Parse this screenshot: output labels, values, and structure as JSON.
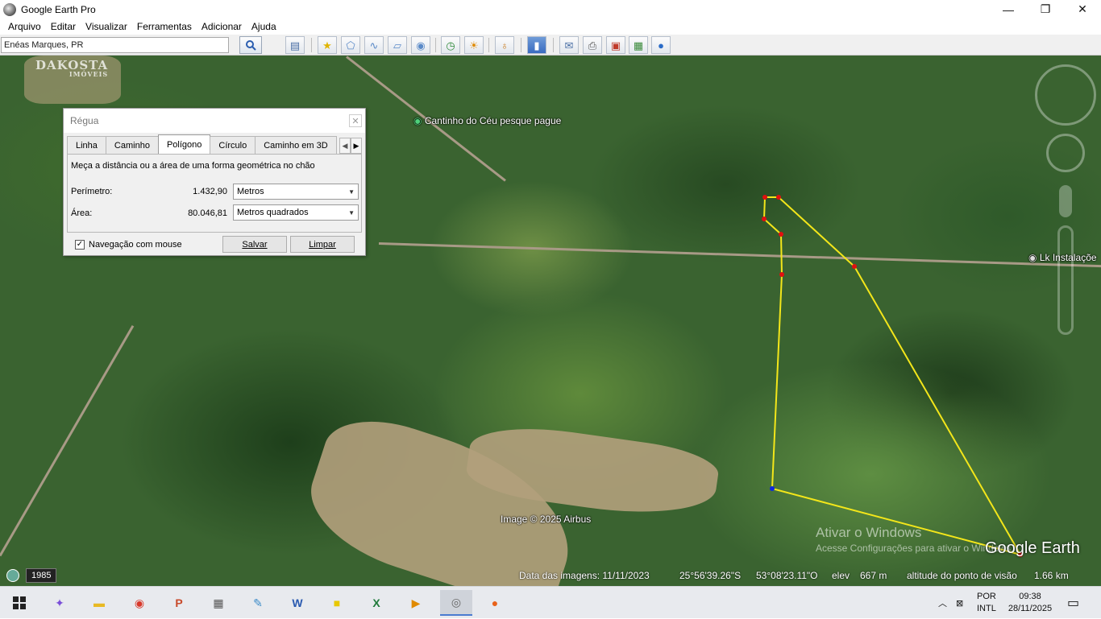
{
  "window": {
    "title": "Google Earth Pro",
    "minimize": "—",
    "maximize": "❐",
    "close": "✕"
  },
  "menu": [
    "Arquivo",
    "Editar",
    "Visualizar",
    "Ferramentas",
    "Adicionar",
    "Ajuda"
  ],
  "search": {
    "value": "Enéas Marques, PR"
  },
  "dialog": {
    "title": "Régua",
    "close": "✕",
    "tabs": [
      "Linha",
      "Caminho",
      "Polígono",
      "Círculo",
      "Caminho em 3D"
    ],
    "active_tab": "Polígono",
    "description": "Meça a distância ou a área de uma forma geométrica no chão",
    "perimeter_label": "Perímetro:",
    "perimeter_value": "1.432,90",
    "perimeter_unit": "Metros",
    "area_label": "Área:",
    "area_value": "80.046,81",
    "area_unit": "Metros quadrados",
    "mouse_nav_label": "Navegação com mouse",
    "mouse_nav_checked": true,
    "save_label": "Salvar",
    "clear_label": "Limpar"
  },
  "map": {
    "watermark": "DAKOSTA",
    "watermark_sub": "IMÓVEIS",
    "place1": "Cantinho do Céu pesque pague",
    "place2": "Lk Instalaçõe",
    "copyright": "Image © 2025 Airbus",
    "logo": "Google Earth",
    "year": "1985",
    "activate_title": "Ativar o Windows",
    "activate_sub": "Acesse Configurações para ativar o Windows.",
    "polygon_color": "#f3e61a"
  },
  "status": {
    "imagery_date": "Data das imagens: 11/11/2023",
    "lat": "25°56'39.26\"S",
    "lon": "53°08'23.11\"O",
    "elev_label": "elev",
    "elev_value": "667 m",
    "eye_label": "altitude do ponto de visão",
    "eye_value": "1.66 km"
  },
  "taskbar": {
    "lang": "POR",
    "layout": "INTL",
    "time": "09:38",
    "date": "28/11/2025"
  }
}
